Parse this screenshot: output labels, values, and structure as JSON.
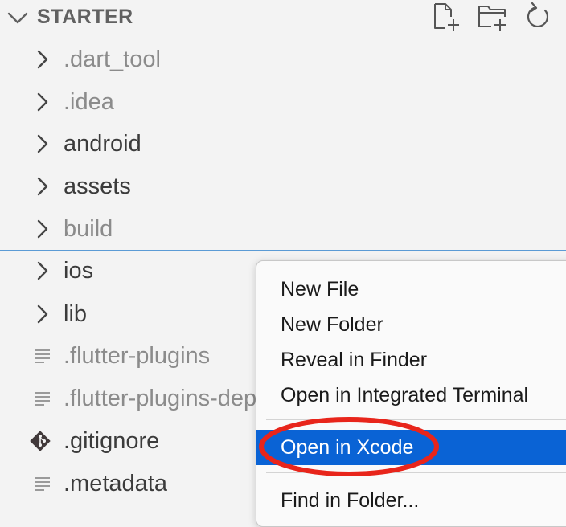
{
  "explorer": {
    "section_title": "STARTER",
    "actions": [
      {
        "icon": "new-file-icon"
      },
      {
        "icon": "new-folder-icon"
      },
      {
        "icon": "refresh-icon"
      }
    ],
    "items": [
      {
        "label": ".dart_tool",
        "type": "folder",
        "dimmed": true
      },
      {
        "label": ".idea",
        "type": "folder",
        "dimmed": true
      },
      {
        "label": "android",
        "type": "folder",
        "dimmed": false
      },
      {
        "label": "assets",
        "type": "folder",
        "dimmed": false
      },
      {
        "label": "build",
        "type": "folder",
        "dimmed": true
      },
      {
        "label": "ios",
        "type": "folder",
        "dimmed": false,
        "focused": true
      },
      {
        "label": "lib",
        "type": "folder",
        "dimmed": false
      },
      {
        "label": ".flutter-plugins",
        "type": "file",
        "dimmed": true
      },
      {
        "label": ".flutter-plugins-dependencies",
        "type": "file",
        "dimmed": true
      },
      {
        "label": ".gitignore",
        "type": "git-file",
        "dimmed": false
      },
      {
        "label": ".metadata",
        "type": "file",
        "dimmed": false
      }
    ]
  },
  "context_menu": {
    "items": [
      {
        "label": "New File"
      },
      {
        "label": "New Folder"
      },
      {
        "label": "Reveal in Finder"
      },
      {
        "label": "Open in Integrated Terminal"
      },
      {
        "label": "Open in Xcode",
        "highlighted": true
      },
      {
        "label": "Find in Folder..."
      }
    ]
  },
  "colors": {
    "sidebar_background": "#f3f3f3",
    "focus_border": "#5b9bd5",
    "menu_highlight": "#0a63d5",
    "annotation_circle": "#e8251b",
    "text_dimmed": "#8b8b8b",
    "text_normal": "#3b3b3b"
  }
}
